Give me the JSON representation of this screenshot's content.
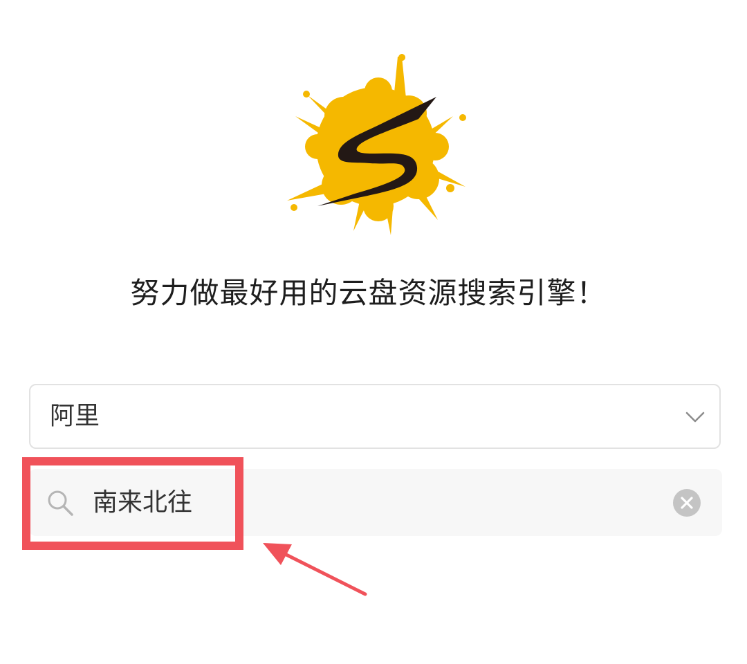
{
  "header": {
    "logo_icon": "splash-s-logo-icon",
    "slogan": "努力做最好用的云盘资源搜索引擎！"
  },
  "source_select": {
    "selected": "阿里",
    "icon": "chevron-down-icon"
  },
  "search": {
    "value": "南来北往",
    "icon": "search-icon",
    "clear_icon": "clear-icon"
  },
  "annotation": {
    "color": "#f0525a"
  },
  "colors": {
    "logo_yellow": "#f5b800",
    "logo_dark": "#231815",
    "input_bg": "#f7f7f7",
    "border": "#e2e2e2"
  }
}
